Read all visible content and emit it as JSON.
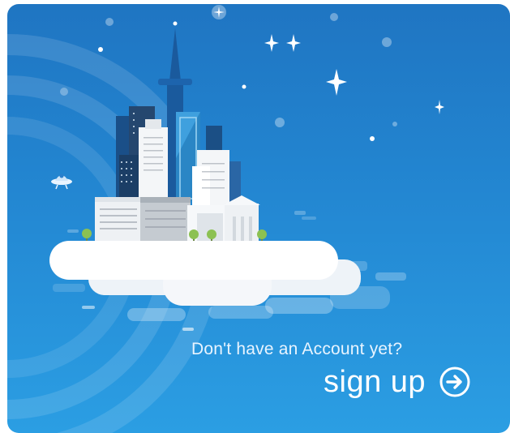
{
  "signup_card": {
    "prompt_text": "Don't have an Account yet?",
    "signup_label": "sign up",
    "arrow_icon": "arrow-right-circle-icon",
    "colors": {
      "background_top": "#1f75c2",
      "background_bottom": "#2b9ee3",
      "text": "#ffffff"
    }
  }
}
